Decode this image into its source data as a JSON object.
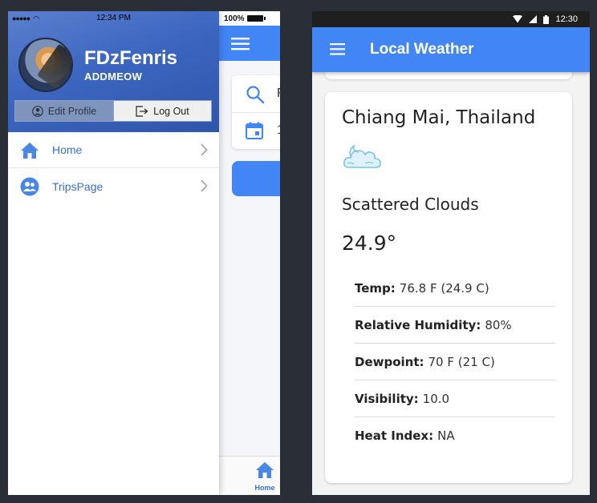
{
  "left_phone": {
    "status": {
      "time": "12:34 PM",
      "battery": "100%"
    },
    "drawer": {
      "username": "FDzFenris",
      "handle": "ADDMEOW",
      "edit_profile": "Edit Profile",
      "logout": "Log Out",
      "items": [
        {
          "label": "Home",
          "icon": "home-icon"
        },
        {
          "label": "TripsPage",
          "icon": "people-icon"
        }
      ]
    },
    "main": {
      "search_text": "F",
      "date_text": "1",
      "tab_home": "Home"
    },
    "colors": {
      "accent": "#4285f4",
      "link": "#3b6fd1",
      "header": "#3c66c0"
    }
  },
  "right_phone": {
    "status": {
      "time": "12:30"
    },
    "app_title": "Local Weather",
    "card": {
      "location": "Chiang Mai, Thailand",
      "icon": "partly-cloudy-icon",
      "condition": "Scattered Clouds",
      "temperature": "24.9°",
      "details": [
        {
          "key": "Temp:",
          "value": "76.8 F (24.9 C)"
        },
        {
          "key": "Relative Humidity:",
          "value": "80%"
        },
        {
          "key": "Dewpoint:",
          "value": "70 F (21 C)"
        },
        {
          "key": "Visibility:",
          "value": "10.0"
        },
        {
          "key": "Heat Index:",
          "value": "NA"
        }
      ]
    }
  }
}
